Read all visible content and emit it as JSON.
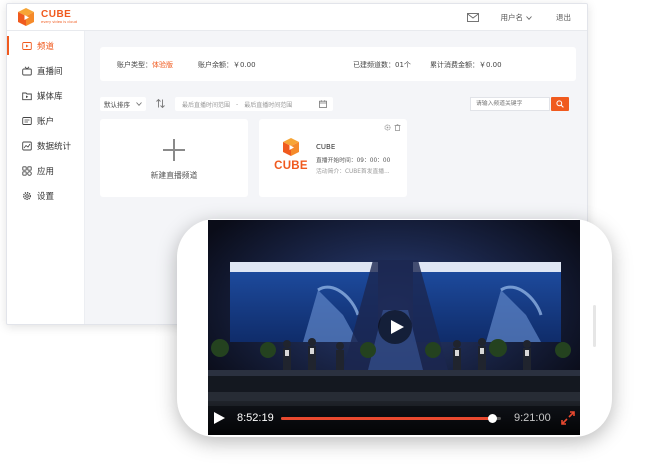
{
  "app": {
    "logo_text": "CUBE",
    "logo_tagline": "every video is cloud",
    "accent_color": "#f05a1e"
  },
  "topbar": {
    "mail_icon": "mail-icon",
    "username": "用户名",
    "logout": "退出"
  },
  "sidebar": {
    "items": [
      {
        "label": "频道",
        "icon": "channel-icon",
        "active": true
      },
      {
        "label": "直播间",
        "icon": "live-room-icon",
        "active": false
      },
      {
        "label": "媒体库",
        "icon": "media-library-icon",
        "active": false
      },
      {
        "label": "账户",
        "icon": "account-icon",
        "active": false
      },
      {
        "label": "数据统计",
        "icon": "statistics-icon",
        "active": false
      },
      {
        "label": "应用",
        "icon": "apps-icon",
        "active": false
      },
      {
        "label": "设置",
        "icon": "settings-icon",
        "active": false
      }
    ]
  },
  "stats": {
    "account_type_label": "账户类型：",
    "account_type_value": "体验版",
    "balance": "账户余额：￥0.00",
    "channels": "已建频道数：01个",
    "total_spent": "累计消费金额：￥0.00"
  },
  "filter": {
    "sort_label": "默认排序",
    "start_placeholder": "最后直播时间范围",
    "end_placeholder": "最后直播时间范围",
    "range_separator": "-",
    "search_placeholder": "请输入频道关键字"
  },
  "new_channel": {
    "label": "新建直播频道"
  },
  "channel": {
    "logo_text": "CUBE",
    "title": "CUBE",
    "start_time": "直播开始时间：09：00：00",
    "description": "活动简介：CUBE首发直播..."
  },
  "player": {
    "current_time": "8:52:19",
    "total_time": "9:21:00",
    "progress": 0.96,
    "progress_color": "#e8492f"
  }
}
